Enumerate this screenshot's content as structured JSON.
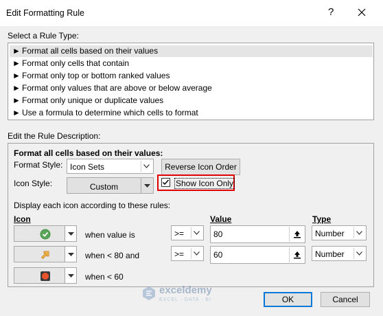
{
  "dialog": {
    "title": "Edit Formatting Rule",
    "help_label": "?",
    "close_label": "×"
  },
  "rule_type": {
    "heading": "Select a Rule Type:",
    "items": [
      "Format all cells based on their values",
      "Format only cells that contain",
      "Format only top or bottom ranked values",
      "Format only values that are above or below average",
      "Format only unique or duplicate values",
      "Use a formula to determine which cells to format"
    ],
    "selected_index": 0
  },
  "description": {
    "heading": "Edit the Rule Description:",
    "subheading": "Format all cells based on their values:",
    "format_style_label": "Format Style:",
    "format_style_value": "Icon Sets",
    "reverse_button": "Reverse Icon Order",
    "icon_style_label": "Icon Style:",
    "icon_style_value": "Custom",
    "show_icon_only_label": "Show Icon Only",
    "show_icon_only_checked": true,
    "rules_caption": "Display each icon according to these rules:",
    "col_icon": "Icon",
    "col_value": "Value",
    "col_type": "Type",
    "rows": [
      {
        "icon": "green-check-circle-icon",
        "text": "when value is",
        "operator": ">=",
        "value": "80",
        "type": "Number"
      },
      {
        "icon": "orange-up-right-arrow-icon",
        "text": "when < 80 and",
        "operator": ">=",
        "value": "60",
        "type": "Number"
      },
      {
        "icon": "red-stop-square-icon",
        "text": "when < 60"
      }
    ]
  },
  "footer": {
    "ok": "OK",
    "cancel": "Cancel"
  },
  "watermark": {
    "brand": "exceldemy",
    "tagline": "EXCEL · DATA · BI"
  },
  "colors": {
    "highlight": "#e00000",
    "selection": "#e5e5e5",
    "default_button_border": "#0078d7"
  }
}
